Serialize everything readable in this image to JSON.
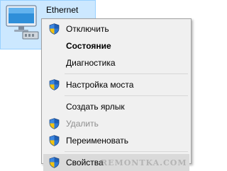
{
  "adapter": {
    "name": "Ethernet",
    "icon": "network-adapter-icon"
  },
  "context_menu": {
    "items": [
      {
        "label": "Отключить",
        "icon": "shield-icon",
        "bold": false,
        "disabled": false
      },
      {
        "label": "Состояние",
        "icon": null,
        "bold": true,
        "disabled": false
      },
      {
        "label": "Диагностика",
        "icon": null,
        "bold": false,
        "disabled": false
      },
      {
        "label": "Настройка моста",
        "icon": "shield-icon",
        "bold": false,
        "disabled": false
      },
      {
        "label": "Создать ярлык",
        "icon": null,
        "bold": false,
        "disabled": false
      },
      {
        "label": "Удалить",
        "icon": "shield-icon",
        "bold": false,
        "disabled": true
      },
      {
        "label": "Переименовать",
        "icon": "shield-icon",
        "bold": false,
        "disabled": false
      },
      {
        "label": "Свойства",
        "icon": "shield-icon",
        "bold": false,
        "disabled": false,
        "highlighted": true
      }
    ]
  },
  "watermark": "REMONTKA.COM",
  "colors": {
    "selection_fill": "#cce8ff",
    "selection_border": "#99d1ff",
    "menu_background": "#f0f0f0",
    "menu_highlight": "#dadada",
    "disabled_text": "#8d8d8d"
  }
}
